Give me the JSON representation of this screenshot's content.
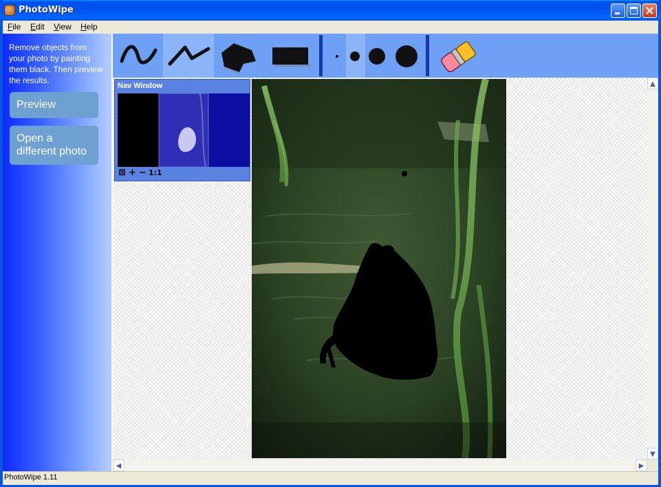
{
  "window": {
    "title": "PhotoWipe"
  },
  "menu": {
    "items": [
      {
        "u": "F",
        "rest": "ile"
      },
      {
        "u": "E",
        "rest": "dit"
      },
      {
        "u": "V",
        "rest": "iew"
      },
      {
        "u": "H",
        "rest": "elp"
      }
    ]
  },
  "sidebar": {
    "intro": "Remove objects from your photo by painting them black. Then preview the results.",
    "preview_label": "Preview",
    "open_label": "Open a different photo"
  },
  "toolbar": {
    "tools": [
      "freehand-brush",
      "line-brush",
      "polygon-fill",
      "rectangle-fill"
    ],
    "active_tool": "line-brush",
    "brush_sizes": [
      "tiny",
      "small",
      "medium",
      "large"
    ],
    "active_size": "small",
    "eraser": "eraser"
  },
  "nav": {
    "title": "Nav Window",
    "zoom_label": "1:1"
  },
  "status": {
    "text": "PhotoWipe 1.11"
  }
}
